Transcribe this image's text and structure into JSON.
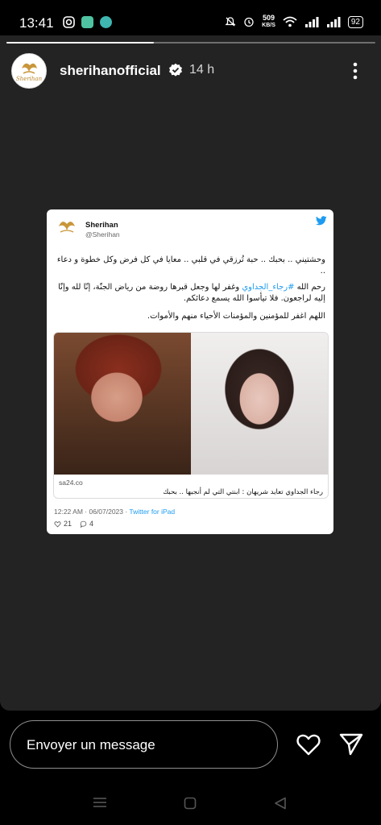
{
  "status_bar": {
    "time": "13:41",
    "net_speed_value": "509",
    "net_speed_unit": "KB/S",
    "battery": "92"
  },
  "story": {
    "progress": 0.4,
    "username": "sherihanofficial",
    "time_ago": "14 h",
    "avatar_logo": "Sherihan"
  },
  "tweet": {
    "name": "Sherihan",
    "handle": "@Sherihan",
    "line1": "وحشتيني .. بحبك .. حبة تُرزقي في قلبي .. معايا في كل فرض وكل خطوة و دعاء ..",
    "line2_before": "رحم الله ",
    "line2_hashtag": "#رجاء_الجداوي",
    "line2_after": " وغفر لها وجعل قبرها روضة من رياض الجنّة، إنّا لله وإنّا إليه لراجعون. فلا تيأسوا الله يسمع دعائكم.",
    "line3": "اللهم اغفر للمؤمنين والمؤمنات الأحياء منهم والأموات.",
    "card_domain": "sa24.co",
    "card_title": "رجاء الجداوي تعايد شريهان : ابنتي التي لم أنجبها .. بحبك",
    "timestamp": "12:22 AM · 06/07/2023 · ",
    "source": "Twitter for iPad",
    "likes": "21",
    "replies": "4"
  },
  "bottom": {
    "message_placeholder": "Envoyer un message"
  },
  "colors": {
    "twitter_blue": "#1d9bf0",
    "story_bg": "#232323",
    "verified_badge": "#ffffff"
  },
  "icons": [
    "instagram-icon",
    "notification-icon",
    "notification-icon",
    "mute-icon",
    "alarm-icon",
    "wifi-icon",
    "signal-icon",
    "battery-icon",
    "verified-icon",
    "more-icon",
    "twitter-bird-icon",
    "heart-icon",
    "comment-icon",
    "send-icon",
    "menu-nav-icon",
    "home-nav-icon",
    "back-nav-icon"
  ]
}
